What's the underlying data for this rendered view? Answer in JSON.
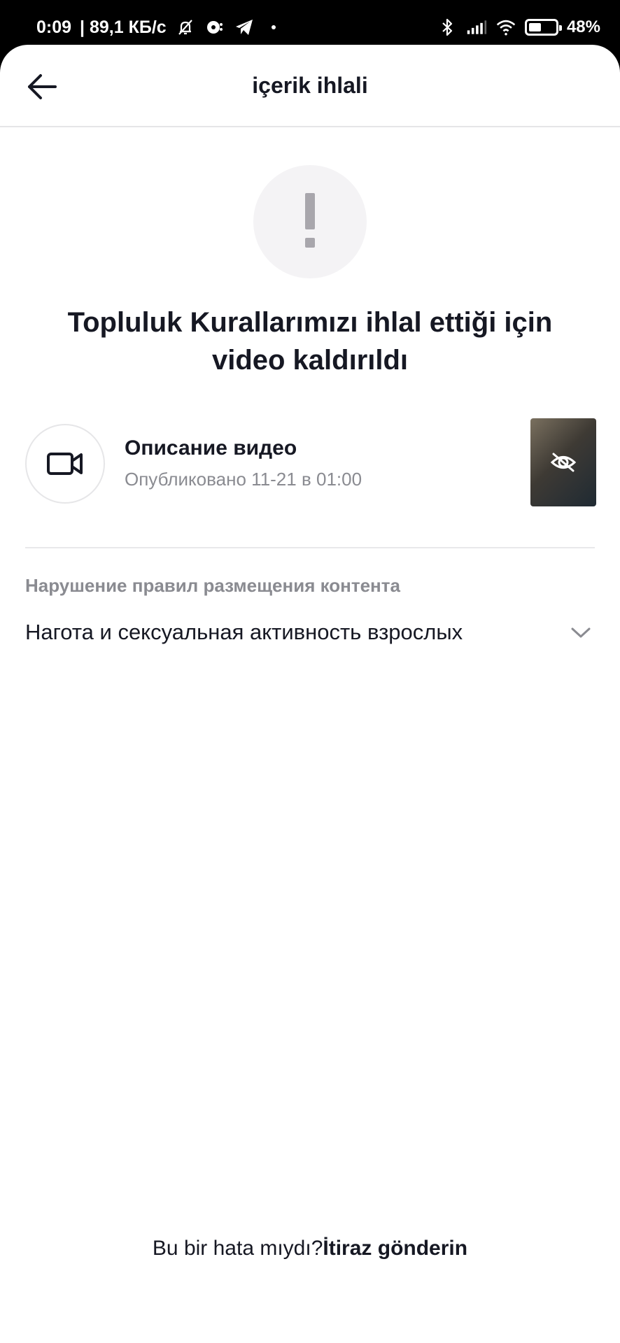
{
  "status_bar": {
    "time": "0:09",
    "network_speed": "| 89,1 КБ/с",
    "battery_percent": "48%",
    "battery_level": 0.48,
    "icons": [
      "muted-bell-icon",
      "mobile-app-icon",
      "telegram-icon",
      "notification-dot-icon",
      "bluetooth-icon",
      "signal-icon",
      "wifi-icon",
      "battery-icon"
    ]
  },
  "header": {
    "title": "içerik ihlali",
    "back_icon": "arrow-left-icon"
  },
  "warning": {
    "icon": "exclamation-icon",
    "title": "Topluluk Kurallarımızı ihlal ettiği için video kaldırıldı"
  },
  "video": {
    "icon": "video-camera-icon",
    "title": "Описание видео",
    "published": "Опубликовано 11-21 в 01:00",
    "thumbnail_icon": "eye-off-icon"
  },
  "violation": {
    "section_label": "Нарушение правил размещения контента",
    "reason": "Нагота и сексуальная активность взрослых",
    "expand_icon": "chevron-down-icon"
  },
  "footer": {
    "question": "Bu bir hata mıydı?",
    "appeal_link": "İtiraz gönderin"
  },
  "colors": {
    "text_primary": "#161823",
    "text_secondary": "#8a8b91",
    "icon_circle_bg": "#f4f3f5",
    "divider": "#e8e8ea"
  }
}
